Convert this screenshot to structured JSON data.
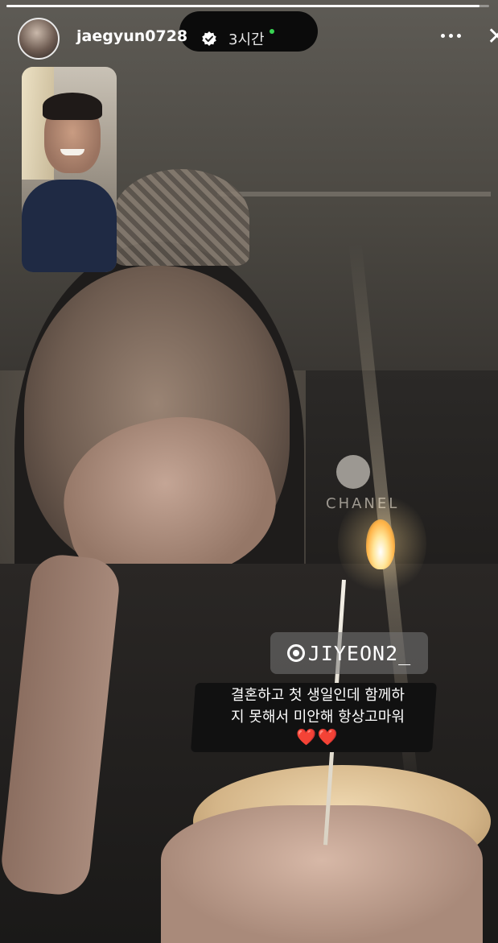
{
  "story": {
    "username": "jaegyun0728",
    "time_ago": "3시간",
    "progress": 0.98,
    "verified": true
  },
  "icons": {
    "avatar": "profile-avatar",
    "verified": "verified-badge-icon",
    "more": "more-options-icon",
    "close": "close-icon",
    "mention": "at-sign-icon"
  },
  "mention": {
    "handle": "JIYEON2_"
  },
  "caption": {
    "line1": "결혼하고 첫 생일인데 함께하",
    "line2": "지 못해서 미안해 항상고마워",
    "hearts": "❤️❤️"
  },
  "background": {
    "bag_text": "CHANEL"
  },
  "colors": {
    "verified_badge": "#ffffff",
    "heart": "#e0202a",
    "online_dot": "#39d353"
  }
}
